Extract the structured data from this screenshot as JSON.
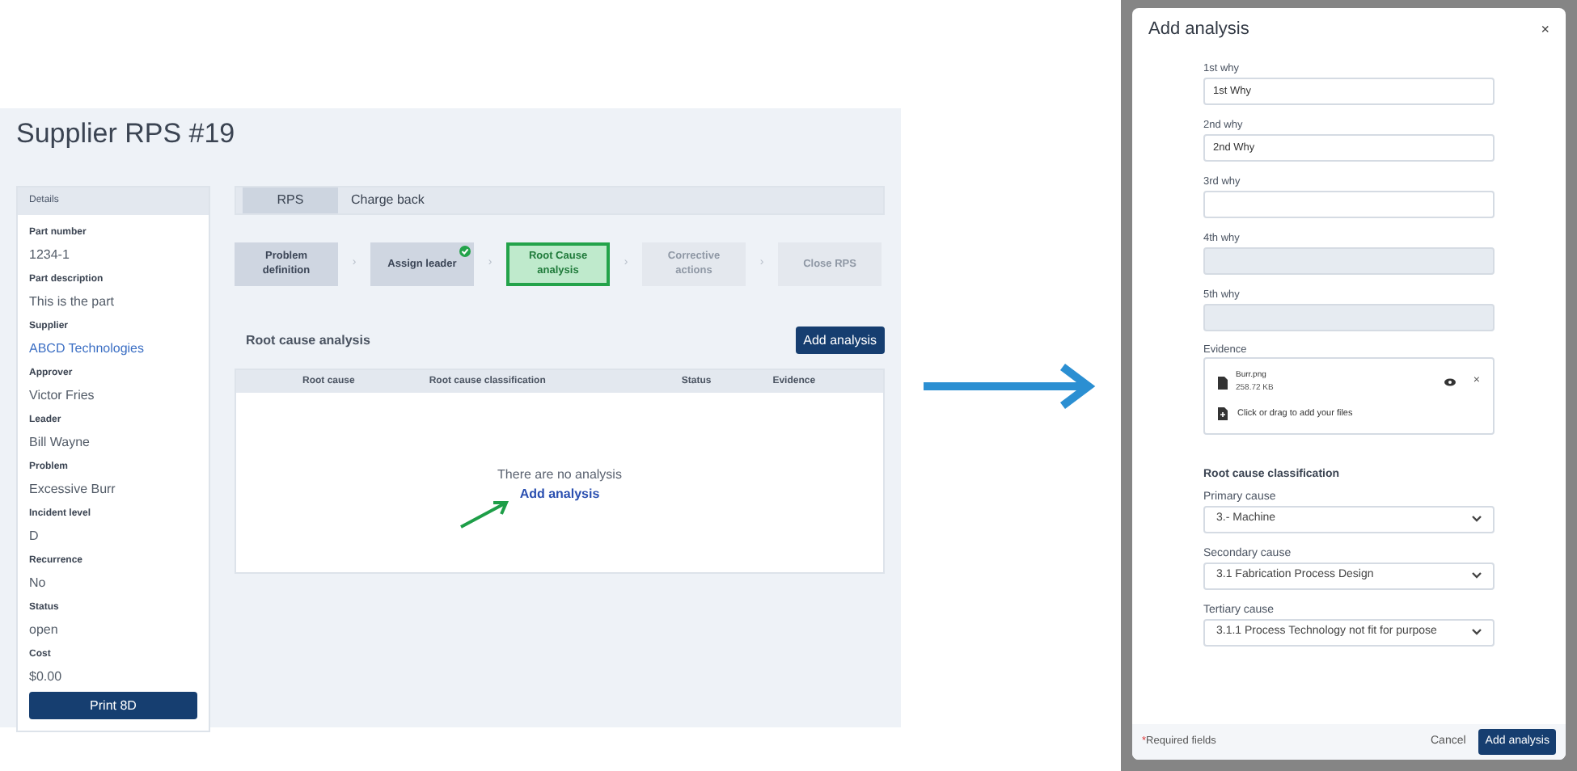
{
  "page": {
    "title": "Supplier RPS #19"
  },
  "details": {
    "heading": "Details",
    "fields": [
      {
        "label": "Part number",
        "value": "1234-1",
        "link": false
      },
      {
        "label": "Part description",
        "value": "This is the part",
        "link": false
      },
      {
        "label": "Supplier",
        "value": "ABCD Technologies",
        "link": true
      },
      {
        "label": "Approver",
        "value": "Victor Fries",
        "link": false
      },
      {
        "label": "Leader",
        "value": "Bill Wayne",
        "link": false
      },
      {
        "label": "Problem",
        "value": "Excessive Burr",
        "link": false
      },
      {
        "label": "Incident level",
        "value": "D",
        "link": false
      },
      {
        "label": "Recurrence",
        "value": "No",
        "link": false
      },
      {
        "label": "Status",
        "value": "open",
        "link": false
      },
      {
        "label": "Cost",
        "value": "$0.00",
        "link": false
      }
    ],
    "print_button": "Print 8D"
  },
  "tabs": [
    {
      "label": "RPS",
      "selected": true
    },
    {
      "label": "Charge back",
      "selected": false
    }
  ],
  "steps": [
    {
      "label": "Problem definition",
      "completed": false,
      "selected": false,
      "disabled": false
    },
    {
      "label": "Assign leader",
      "completed": true,
      "selected": false,
      "disabled": false
    },
    {
      "label": "Root Cause analysis",
      "completed": false,
      "selected": true,
      "disabled": false
    },
    {
      "label": "Corrective actions",
      "completed": false,
      "selected": false,
      "disabled": true
    },
    {
      "label": "Close RPS",
      "completed": false,
      "selected": false,
      "disabled": true
    }
  ],
  "step_separator": "›",
  "section": {
    "title": "Root cause analysis",
    "add_button": "Add analysis"
  },
  "table": {
    "columns": [
      "Root cause",
      "Root cause classification",
      "Status",
      "Evidence"
    ],
    "empty_text": "There are no analysis",
    "empty_link": "Add analysis"
  },
  "dialog": {
    "title": "Add analysis",
    "close": "×",
    "whys": [
      {
        "label": "1st why",
        "value": "1st Why",
        "disabled": false
      },
      {
        "label": "2nd why",
        "value": "2nd Why",
        "disabled": false
      },
      {
        "label": "3rd why",
        "disabled": false
      },
      {
        "label": "4th why",
        "disabled": true
      },
      {
        "label": "5th why",
        "disabled": true
      }
    ],
    "evidence": {
      "label": "Evidence",
      "files": [
        {
          "name": "Burr.png",
          "size": "258.72 KB"
        }
      ],
      "dropzone": "Click or drag to add your files"
    },
    "classification": {
      "heading": "Root cause classification",
      "selects": [
        {
          "label": "Primary cause",
          "value": "3.- Machine"
        },
        {
          "label": "Secondary cause",
          "value": "3.1 Fabrication Process Design"
        },
        {
          "label": "Tertiary cause",
          "value": "3.1.1 Process Technology not fit for purpose"
        }
      ]
    },
    "footer": {
      "required_mark": "*",
      "required_text": "Required fields",
      "cancel": "Cancel",
      "submit": "Add analysis"
    }
  }
}
